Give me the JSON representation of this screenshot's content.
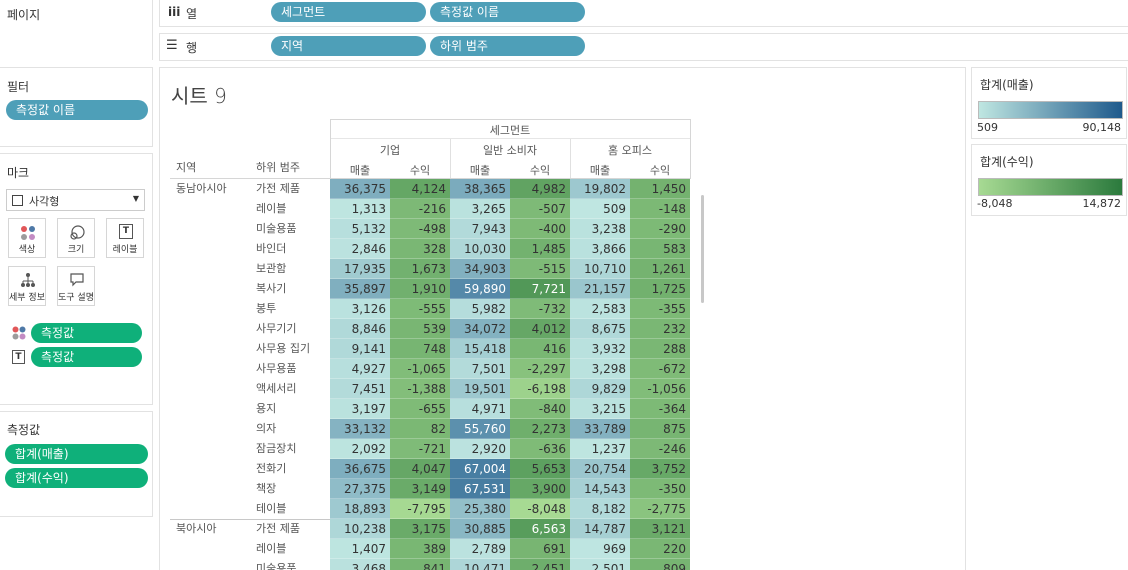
{
  "shelves": {
    "pages_label": "페이지",
    "columns_label": "열",
    "rows_label": "행",
    "columns_pills": [
      "세그먼트",
      "측정값 이름"
    ],
    "rows_pills": [
      "지역",
      "하위 범주"
    ]
  },
  "filters": {
    "title": "필터",
    "pill": "측정값 이름"
  },
  "marks": {
    "title": "마크",
    "type": "사각형",
    "buttons": {
      "color": "색상",
      "size": "크기",
      "label": "레이블",
      "detail": "세부 정보",
      "tooltip": "도구 설명"
    },
    "pills": [
      "측정값",
      "측정값"
    ]
  },
  "measure_values": {
    "title": "측정값",
    "pills": [
      "합계(매출)",
      "합계(수익)"
    ]
  },
  "sheet": {
    "title": "시트 9"
  },
  "table": {
    "segment_header": "세그먼트",
    "segments": [
      "기업",
      "일반 소비자",
      "홈 오피스"
    ],
    "measures": [
      "매출",
      "수익"
    ],
    "row_headers": [
      "지역",
      "하위 범주"
    ],
    "regions": [
      {
        "name": "동남아시아",
        "rows": [
          {
            "sub": "가전 제품",
            "v": [
              "36,375",
              "4,124",
              "38,365",
              "4,982",
              "19,802",
              "1,450"
            ]
          },
          {
            "sub": "레이블",
            "v": [
              "1,313",
              "-216",
              "3,265",
              "-507",
              "509",
              "-148"
            ]
          },
          {
            "sub": "미술용품",
            "v": [
              "5,132",
              "-498",
              "7,943",
              "-400",
              "3,238",
              "-290"
            ]
          },
          {
            "sub": "바인더",
            "v": [
              "2,846",
              "328",
              "10,030",
              "1,485",
              "3,866",
              "583"
            ]
          },
          {
            "sub": "보관함",
            "v": [
              "17,935",
              "1,673",
              "34,903",
              "-515",
              "10,710",
              "1,261"
            ]
          },
          {
            "sub": "복사기",
            "v": [
              "35,897",
              "1,910",
              "59,890",
              "7,721",
              "21,157",
              "1,725"
            ]
          },
          {
            "sub": "봉투",
            "v": [
              "3,126",
              "-555",
              "5,982",
              "-732",
              "2,583",
              "-355"
            ]
          },
          {
            "sub": "사무기기",
            "v": [
              "8,846",
              "539",
              "34,072",
              "4,012",
              "8,675",
              "232"
            ]
          },
          {
            "sub": "사무용 집기",
            "v": [
              "9,141",
              "748",
              "15,418",
              "416",
              "3,932",
              "288"
            ]
          },
          {
            "sub": "사무용품",
            "v": [
              "4,927",
              "-1,065",
              "7,501",
              "-2,297",
              "3,298",
              "-672"
            ]
          },
          {
            "sub": "액세서리",
            "v": [
              "7,451",
              "-1,388",
              "19,501",
              "-6,198",
              "9,829",
              "-1,056"
            ]
          },
          {
            "sub": "용지",
            "v": [
              "3,197",
              "-655",
              "4,971",
              "-840",
              "3,215",
              "-364"
            ]
          },
          {
            "sub": "의자",
            "v": [
              "33,132",
              "82",
              "55,760",
              "2,273",
              "33,789",
              "875"
            ]
          },
          {
            "sub": "잠금장치",
            "v": [
              "2,092",
              "-721",
              "2,920",
              "-636",
              "1,237",
              "-246"
            ]
          },
          {
            "sub": "전화기",
            "v": [
              "36,675",
              "4,047",
              "67,004",
              "5,653",
              "20,754",
              "3,752"
            ]
          },
          {
            "sub": "책장",
            "v": [
              "27,375",
              "3,149",
              "67,531",
              "3,900",
              "14,543",
              "-350"
            ]
          },
          {
            "sub": "테이블",
            "v": [
              "18,893",
              "-7,795",
              "25,380",
              "-8,048",
              "8,182",
              "-2,775"
            ]
          }
        ]
      },
      {
        "name": "북아시아",
        "rows": [
          {
            "sub": "가전 제품",
            "v": [
              "10,238",
              "3,175",
              "30,885",
              "6,563",
              "14,787",
              "3,121"
            ]
          },
          {
            "sub": "레이블",
            "v": [
              "1,407",
              "389",
              "2,789",
              "691",
              "969",
              "220"
            ]
          },
          {
            "sub": "미술용품",
            "v": [
              "3,468",
              "841",
              "10,471",
              "2,451",
              "2,501",
              "809"
            ]
          }
        ]
      }
    ]
  },
  "legends": {
    "sales": {
      "title": "합계(매출)",
      "min": "509",
      "max": "90,148"
    },
    "profit": {
      "title": "합계(수익)",
      "min": "-8,048",
      "max": "14,872"
    }
  },
  "colors": {
    "pill_blue": "#4e9fb8",
    "pill_green": "#0fb07a",
    "sales_low": "#bfe6e1",
    "sales_high": "#1f5a8c",
    "profit_low": "#a7da93",
    "profit_high": "#2b7a3d"
  }
}
